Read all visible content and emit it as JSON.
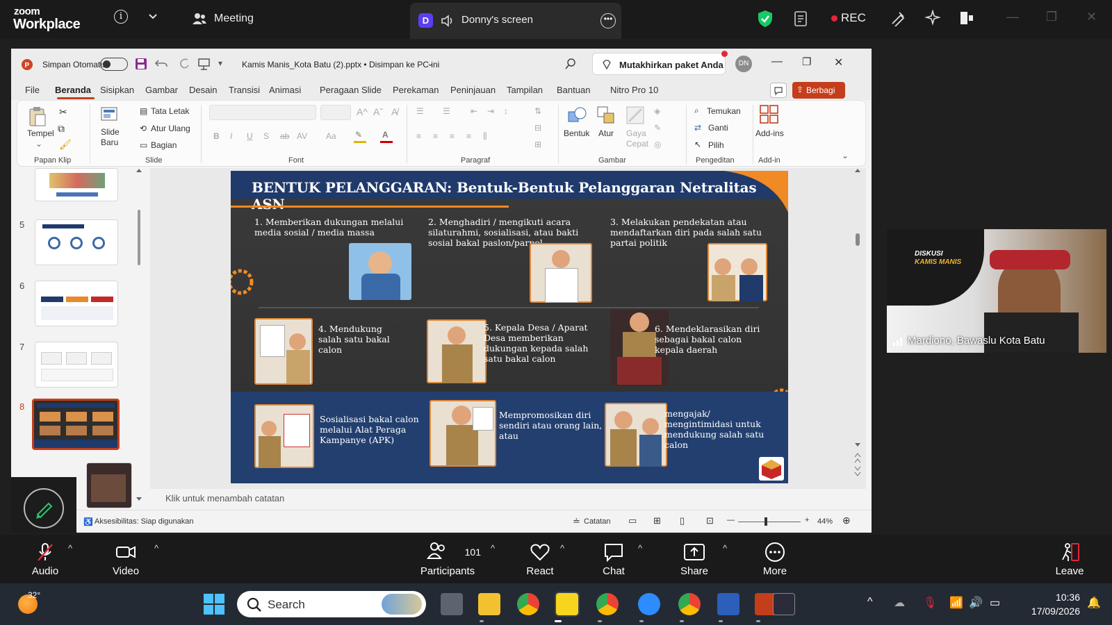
{
  "zoom": {
    "brand_top": "zoom",
    "brand_bottom": "Workplace",
    "meeting_label": "Meeting",
    "screen_initial": "D",
    "screen_tab_label": "Donny's screen",
    "rec_label": "REC"
  },
  "ppt": {
    "autosave_label": "Simpan Otomatis",
    "file_name": "Kamis Manis_Kota Batu (2).pptx • Disimpan ke PC ini",
    "upgrade_label": "Mutakhirkan paket Anda",
    "user_initials": "DN",
    "share_label": "Berbagi",
    "menu": [
      "File",
      "Beranda",
      "Sisipkan",
      "Gambar",
      "Desain",
      "Transisi",
      "Animasi",
      "Peragaan Slide",
      "Perekaman",
      "Peninjauan",
      "Tampilan",
      "Bantuan",
      "Nitro Pro 10"
    ],
    "ribbon": {
      "paste": "Tempel",
      "new_slide": "Slide\nBaru",
      "layout": "Tata Letak",
      "reset": "Atur Ulang",
      "section": "Bagian",
      "shapes": "Bentuk",
      "arrange": "Atur",
      "quick_styles": "Gaya\nCepat",
      "find": "Temukan",
      "replace": "Ganti",
      "select": "Pilih",
      "addins": "Add-ins",
      "groups": [
        "Papan Klip",
        "Slide",
        "Font",
        "Paragraf",
        "Gambar",
        "Pengeditan",
        "Add-in"
      ]
    },
    "thumb_numbers": [
      "5",
      "6",
      "7",
      "8"
    ],
    "notes_placeholder": "Klik untuk menambah catatan",
    "status_accessibility": "Aksesibilitas: Siap digunakan",
    "status_notes": "Catatan",
    "zoom_level": "44%"
  },
  "slide": {
    "title": "BENTUK PELANGGARAN: Bentuk-Bentuk Pelanggaran Netralitas ASN",
    "items": [
      "1. Memberikan dukungan melalui media sosial / media massa",
      "2. Menghadiri / mengikuti acara silaturahmi, sosialisasi, atau bakti sosial bakal paslon/parpol",
      "3. Melakukan pendekatan atau mendaftarkan diri pada salah satu partai politik",
      "4. Mendukung salah satu bakal calon",
      "5. Kepala Desa / Aparat Desa memberikan dukungan kepada salah satu bakal calon",
      "6. Mendeklarasikan diri sebagai bakal calon kepala daerah",
      "Sosialisasi bakal calon melalui Alat Peraga Kampanye (APK)",
      "Mempromosikan diri sendiri atau orang lain, atau",
      "mengajak/ mengintimidasi untuk mendukung salah satu calon"
    ]
  },
  "video": {
    "participant_name": "Mardiono, Bawaslu Kota Batu",
    "banner_line1": "DISKUSI",
    "banner_line2": "KAMIS MANIS"
  },
  "toolbar": {
    "audio": "Audio",
    "video": "Video",
    "participants": "Participants",
    "participants_count": "101",
    "react": "React",
    "chat": "Chat",
    "share": "Share",
    "more": "More",
    "leave": "Leave"
  },
  "taskbar": {
    "weather_temp": "32°",
    "search_placeholder": "Search",
    "time": "10:36",
    "date": "17/09/2026"
  },
  "colors": {
    "zoom_bg": "#1a1a1a",
    "ppt_accent": "#c43e1c",
    "slide_orange": "#f08a24",
    "slide_navy": "#1f3a6b",
    "taskbar_bg": "#242a33"
  }
}
